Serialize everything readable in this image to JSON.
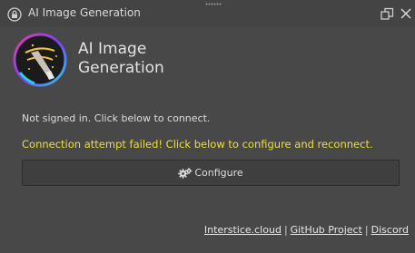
{
  "titlebar": {
    "title": "AI Image Generation"
  },
  "header": {
    "app_name": "AI Image Generation"
  },
  "status": {
    "signed_in_text": "Not signed in. Click below to connect.",
    "error_text": "Connection attempt failed! Click below to configure and reconnect."
  },
  "configure_button": {
    "label": "Configure",
    "icon": "gears-icon"
  },
  "footer": {
    "links": [
      "Interstice.cloud",
      "GitHub Project",
      "Discord"
    ],
    "separator": "|"
  },
  "colors": {
    "background": "#484848",
    "error": "#e8e03c",
    "text": "#dcdcdc"
  }
}
